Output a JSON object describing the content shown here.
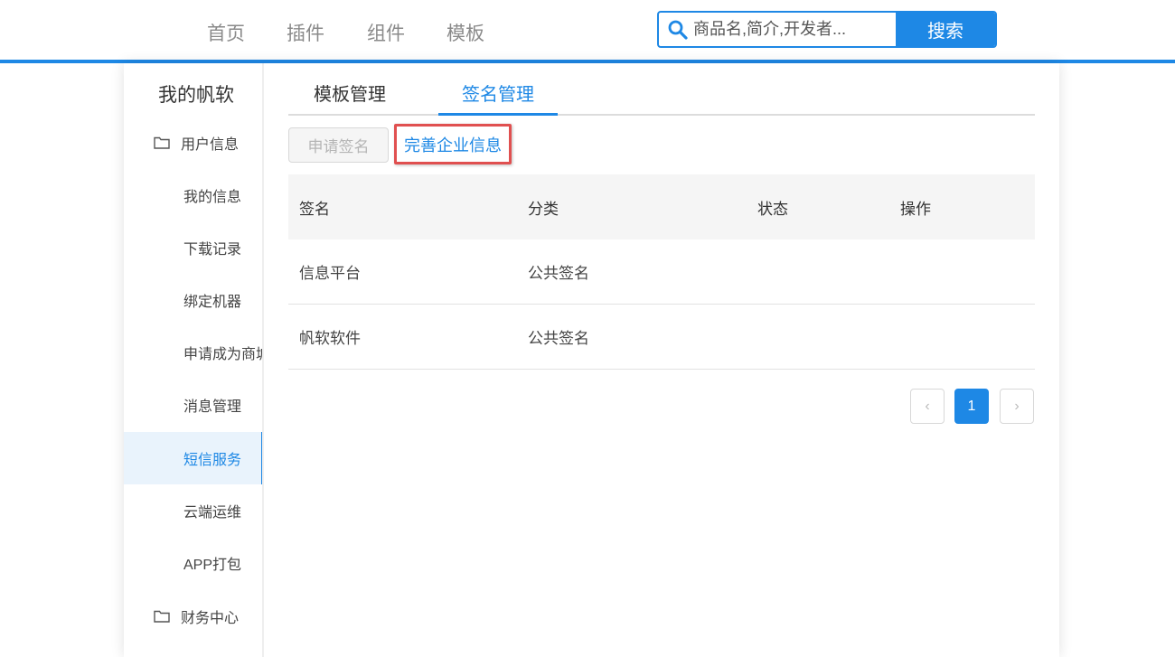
{
  "nav": {
    "items": [
      "首页",
      "插件",
      "组件",
      "模板"
    ],
    "search_placeholder": "商品名,简介,开发者...",
    "search_button": "搜索"
  },
  "sidebar": {
    "title": "我的帆软",
    "group_user": "用户信息",
    "items": [
      "我的信息",
      "下载记录",
      "绑定机器",
      "申请成为商城开发者",
      "消息管理",
      "短信服务",
      "云端运维",
      "APP打包"
    ],
    "active_item": "短信服务",
    "group_finance": "财务中心"
  },
  "tabs": [
    "模板管理",
    "签名管理"
  ],
  "active_tab": "签名管理",
  "actions": {
    "apply_sign": "申请签名",
    "complete_info": "完善企业信息"
  },
  "table": {
    "headers": [
      "签名",
      "分类",
      "状态",
      "操作"
    ],
    "rows": [
      [
        "信息平台",
        "公共签名",
        "",
        ""
      ],
      [
        "帆软软件",
        "公共签名",
        "",
        ""
      ]
    ]
  },
  "pagination": {
    "prev": "‹",
    "current": "1",
    "next": "›"
  },
  "colors": {
    "accent": "#1e88e5",
    "highlight_border": "#e05050"
  }
}
